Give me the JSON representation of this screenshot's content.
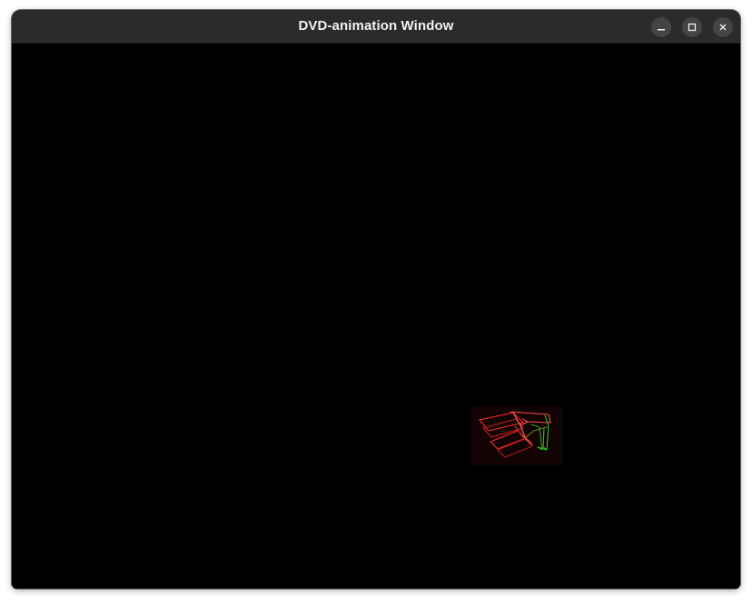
{
  "window": {
    "title": "DVD-animation Window"
  },
  "titlebar_buttons": {
    "minimize_icon": "minimize-icon",
    "maximize_icon": "maximize-icon",
    "close_icon": "close-icon"
  },
  "canvas": {
    "background": "#000000",
    "sprite": {
      "name": "wireframe-chair-logo",
      "colors": {
        "primary": "#ff2a2a",
        "secondary": "#2fbf2f",
        "glow": "#2a0808"
      }
    }
  }
}
